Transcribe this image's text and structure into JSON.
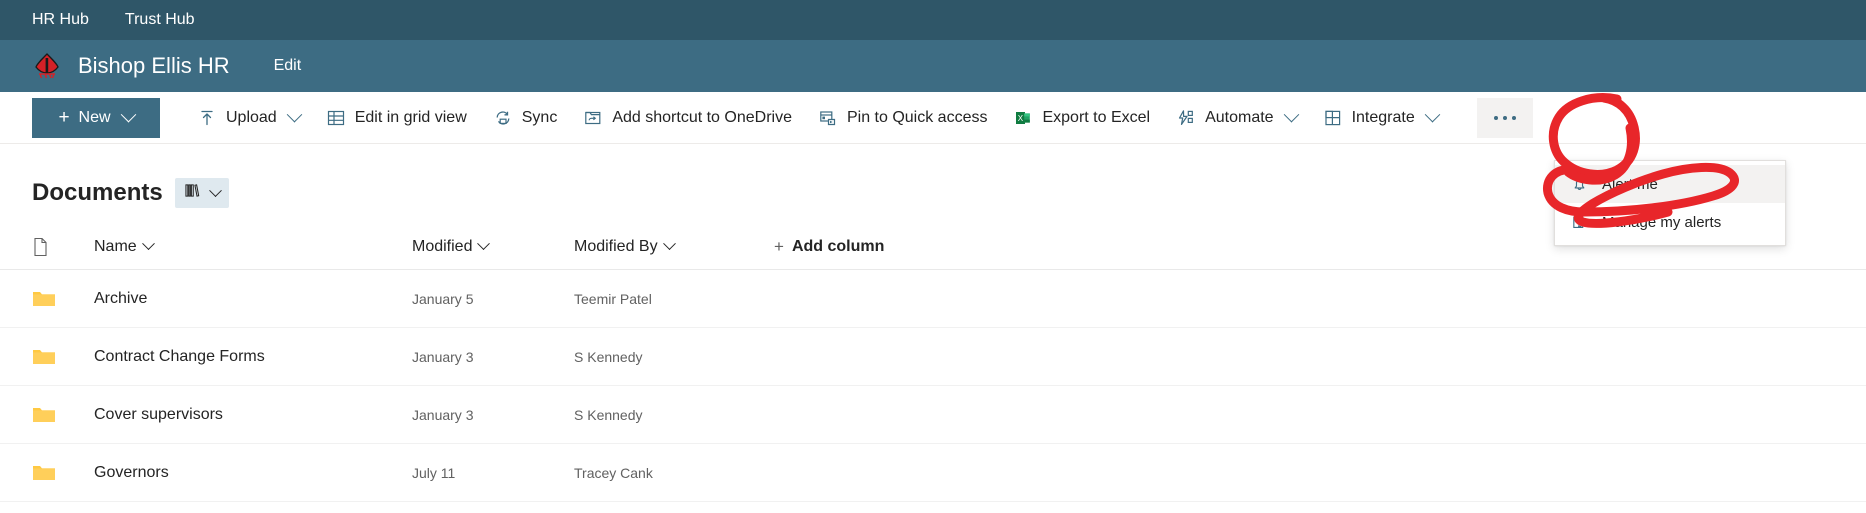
{
  "hubnav": {
    "items": [
      {
        "label": "HR Hub"
      },
      {
        "label": "Trust Hub"
      }
    ]
  },
  "site_header": {
    "logo_icon": "bishop-mitre-logo",
    "title": "Bishop Ellis HR",
    "edit_label": "Edit"
  },
  "command_bar": {
    "new_button": {
      "label": "New",
      "icon": "plus-icon",
      "chevron": "chevron-down-icon"
    },
    "commands": [
      {
        "label": "Upload",
        "icon": "upload-icon",
        "has_chevron": true
      },
      {
        "label": "Edit in grid view",
        "icon": "grid-icon",
        "has_chevron": false
      },
      {
        "label": "Sync",
        "icon": "sync-icon",
        "has_chevron": false
      },
      {
        "label": "Add shortcut to OneDrive",
        "icon": "onedrive-shortcut-icon",
        "has_chevron": false
      },
      {
        "label": "Pin to Quick access",
        "icon": "pin-quick-access-icon",
        "has_chevron": false
      },
      {
        "label": "Export to Excel",
        "icon": "excel-icon",
        "has_chevron": false
      },
      {
        "label": "Automate",
        "icon": "automate-icon",
        "has_chevron": true
      },
      {
        "label": "Integrate",
        "icon": "integrate-icon",
        "has_chevron": true
      }
    ],
    "more_button": {
      "label": "...",
      "icon": "ellipsis-icon"
    }
  },
  "more_menu": {
    "items": [
      {
        "label": "Alert me",
        "icon": "bell-icon",
        "selected": true
      },
      {
        "label": "Manage my alerts",
        "icon": "edit-alerts-icon",
        "selected": false
      }
    ]
  },
  "documents": {
    "title": "Documents",
    "view_selector": {
      "icon": "all-documents-view-icon",
      "chevron": "chevron-down-icon"
    },
    "columns": [
      {
        "label": "Name",
        "has_chevron": true
      },
      {
        "label": "Modified",
        "has_chevron": true
      },
      {
        "label": "Modified By",
        "has_chevron": true
      }
    ],
    "add_column_label": "Add column",
    "rows": [
      {
        "icon": "folder-icon",
        "name": "Archive",
        "modified": "January 5",
        "modified_by": "Teemir Patel"
      },
      {
        "icon": "folder-icon",
        "name": "Contract Change Forms",
        "modified": "January 3",
        "modified_by": "S Kennedy"
      },
      {
        "icon": "folder-icon",
        "name": "Cover supervisors",
        "modified": "January 3",
        "modified_by": "S Kennedy"
      },
      {
        "icon": "folder-icon",
        "name": "Governors",
        "modified": "July 11",
        "modified_by": "Tracey Cank"
      }
    ]
  },
  "annotation": {
    "color": "#E8262A",
    "description": "red-ink-circles-around-more-button-and-alert-me"
  },
  "colors": {
    "hubnav_bg": "#2F5668",
    "site_header_bg": "#3D6C83",
    "accent": "#3D6C83",
    "folder_yellow": "#FFC942",
    "excel_green": "#107C41",
    "text": "#242424",
    "text_dim": "#616161"
  }
}
